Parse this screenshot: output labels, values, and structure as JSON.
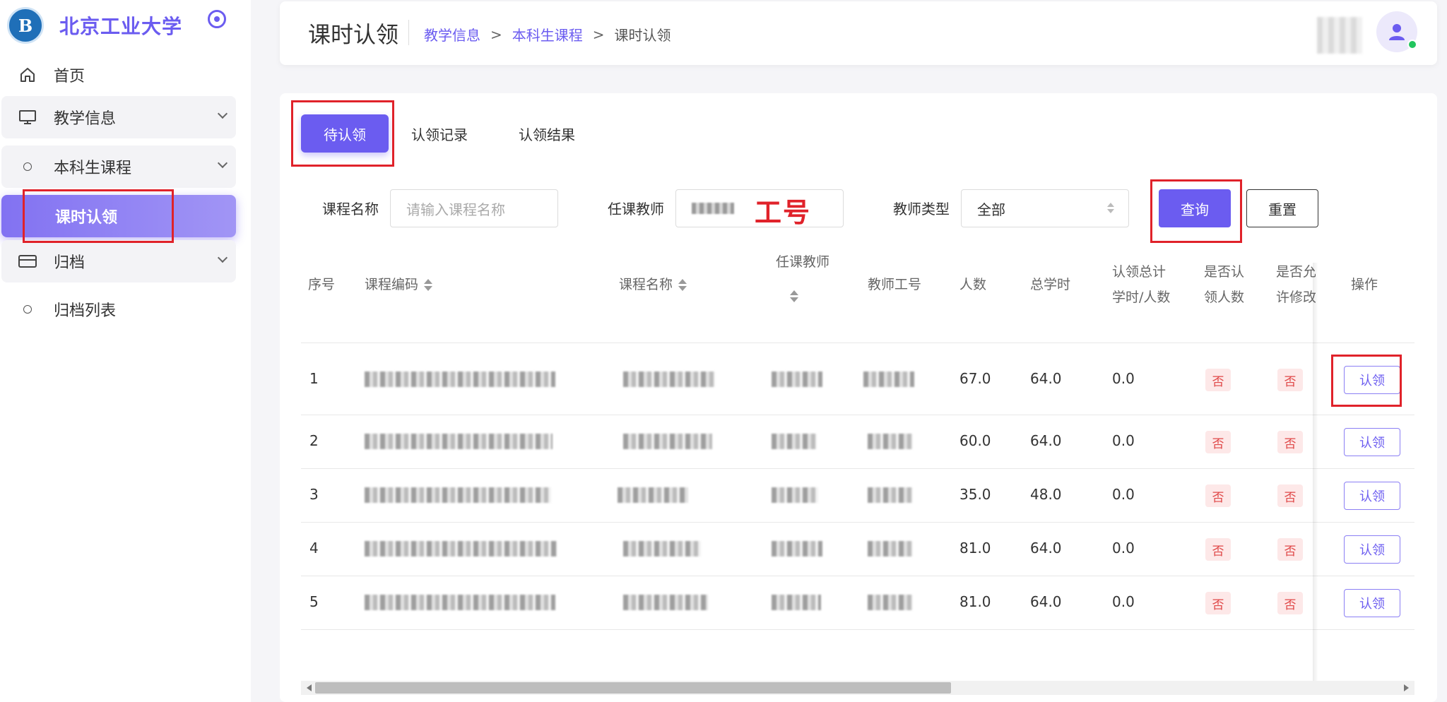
{
  "sidebar": {
    "logo_text": "北京工业大学",
    "logo_mark": "B",
    "items": [
      {
        "label": "首页",
        "icon": "home-icon"
      },
      {
        "label": "教学信息",
        "icon": "monitor-icon"
      },
      {
        "label": "本科生课程",
        "icon": "circle-icon"
      },
      {
        "label": "课时认领"
      },
      {
        "label": "归档",
        "icon": "card-icon"
      },
      {
        "label": "归档列表",
        "icon": "circle-icon"
      }
    ]
  },
  "header": {
    "title": "课时认领",
    "breadcrumb": [
      "教学信息",
      "本科生课程",
      "课时认领"
    ],
    "separator": ">"
  },
  "tabs": [
    {
      "label": "待认领",
      "active": true
    },
    {
      "label": "认领记录",
      "active": false
    },
    {
      "label": "认领结果",
      "active": false
    }
  ],
  "filters": {
    "course_name_label": "课程名称",
    "course_name_placeholder": "请输入课程名称",
    "teacher_label": "任课教师",
    "teacher_type_label": "教师类型",
    "teacher_type_value": "全部",
    "query_button": "查询",
    "reset_button": "重置"
  },
  "annotation": {
    "teacher_id_hint": "工号"
  },
  "table": {
    "columns": {
      "index": "序号",
      "course_code": "课程编码",
      "course_name": "课程名称",
      "teacher": "任课教师",
      "teacher_id": "教师工号",
      "count": "人数",
      "total_hours": "总学时",
      "claimed_total_1": "认领总计",
      "claimed_total_2": "学时/人数",
      "is_claimed_1": "是否认",
      "is_claimed_2": "领人数",
      "allow_modify_1": "是否允",
      "allow_modify_2": "许修改",
      "action": "操作"
    },
    "rows": [
      {
        "index": "1",
        "count": "67.0",
        "total_hours": "64.0",
        "claimed": "0.0",
        "is_claimed": "否",
        "allow_modify": "否",
        "action": "认领"
      },
      {
        "index": "2",
        "count": "60.0",
        "total_hours": "64.0",
        "claimed": "0.0",
        "is_claimed": "否",
        "allow_modify": "否",
        "action": "认领"
      },
      {
        "index": "3",
        "count": "35.0",
        "total_hours": "48.0",
        "claimed": "0.0",
        "is_claimed": "否",
        "allow_modify": "否",
        "action": "认领"
      },
      {
        "index": "4",
        "count": "81.0",
        "total_hours": "64.0",
        "claimed": "0.0",
        "is_claimed": "否",
        "allow_modify": "否",
        "action": "认领"
      },
      {
        "index": "5",
        "count": "81.0",
        "total_hours": "64.0",
        "claimed": "0.0",
        "is_claimed": "否",
        "allow_modify": "否",
        "action": "认领"
      }
    ]
  },
  "colors": {
    "accent": "#6b5cf0",
    "annotation": "#e0222a",
    "tag_bg": "#fde8e8",
    "tag_text": "#e04848"
  }
}
